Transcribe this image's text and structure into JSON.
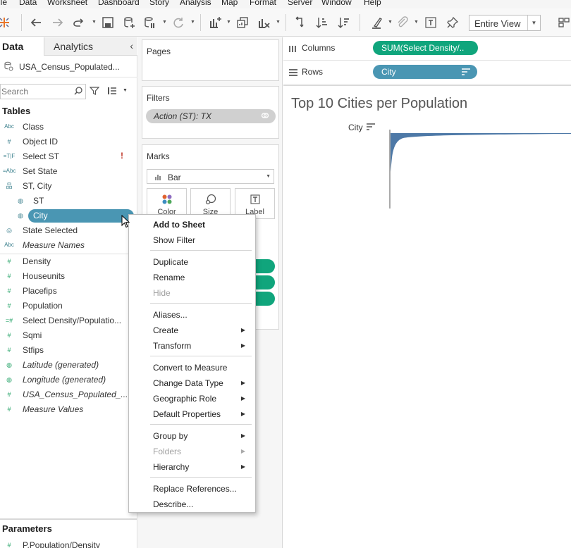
{
  "menubar": [
    "ile",
    "Data",
    "Worksheet",
    "Dashboard",
    "Story",
    "Analysis",
    "Map",
    "Format",
    "Server",
    "Window",
    "Help"
  ],
  "toolbar": {
    "view_fit": "Entire View"
  },
  "datapane": {
    "tab_data": "Data",
    "tab_analytics": "Analytics",
    "datasource": "USA_Census_Populated...",
    "search_placeholder": "Search",
    "tables_title": "Tables",
    "dimensions": [
      {
        "icon": "Abc",
        "name": "Class"
      },
      {
        "icon": "#",
        "name": "Object ID"
      },
      {
        "icon": "=T|F",
        "name": "Select ST",
        "warning": "!"
      },
      {
        "icon": "=Abc",
        "name": "Set State"
      },
      {
        "icon": "hier",
        "name": "ST, City"
      },
      {
        "icon": "geo",
        "name": "ST"
      },
      {
        "icon": "geo",
        "name": "City"
      },
      {
        "icon": "set",
        "name": "State Selected"
      },
      {
        "icon": "Abc",
        "name": "Measure Names"
      }
    ],
    "measures": [
      {
        "icon": "#",
        "name": "Density"
      },
      {
        "icon": "#",
        "name": "Houseunits"
      },
      {
        "icon": "#",
        "name": "Placefips"
      },
      {
        "icon": "#",
        "name": "Population"
      },
      {
        "icon": "=#",
        "name": "Select Density/Populatio..."
      },
      {
        "icon": "#",
        "name": "Sqmi"
      },
      {
        "icon": "#",
        "name": "Stfips"
      },
      {
        "icon": "geo",
        "name": "Latitude (generated)"
      },
      {
        "icon": "geo",
        "name": "Longitude (generated)"
      },
      {
        "icon": "#",
        "name": "USA_Census_Populated_..."
      },
      {
        "icon": "#",
        "name": "Measure Values"
      }
    ],
    "parameters_title": "Parameters",
    "parameters": [
      {
        "name": "P.Population/Density"
      }
    ]
  },
  "cards": {
    "pages": "Pages",
    "filters": "Filters",
    "filter_pill": "Action (ST): TX",
    "marks": "Marks",
    "mark_type": "Bar",
    "mark_buttons": [
      "Color",
      "Size",
      "Label"
    ]
  },
  "shelves": {
    "columns_label": "Columns",
    "columns_pill": "SUM(Select Density/..",
    "rows_label": "Rows",
    "rows_pill": "City"
  },
  "viz": {
    "title": "Top 10 Cities per Population",
    "header": "City"
  },
  "context_menu": [
    {
      "label": "Add to Sheet",
      "bold": true
    },
    {
      "label": "Show Filter"
    },
    {
      "sep": true
    },
    {
      "label": "Duplicate"
    },
    {
      "label": "Rename"
    },
    {
      "label": "Hide",
      "disabled": true
    },
    {
      "sep": true
    },
    {
      "label": "Aliases..."
    },
    {
      "label": "Create",
      "submenu": true
    },
    {
      "label": "Transform",
      "submenu": true
    },
    {
      "sep": true
    },
    {
      "label": "Convert to Measure"
    },
    {
      "label": "Change Data Type",
      "submenu": true
    },
    {
      "label": "Geographic Role",
      "submenu": true
    },
    {
      "label": "Default Properties",
      "submenu": true
    },
    {
      "sep": true
    },
    {
      "label": "Group by",
      "submenu": true
    },
    {
      "label": "Folders",
      "submenu": true,
      "disabled": true
    },
    {
      "label": "Hierarchy",
      "submenu": true
    },
    {
      "sep": true
    },
    {
      "label": "Replace References..."
    },
    {
      "label": "Describe..."
    }
  ],
  "colors": {
    "dimension_pill": "#4a96b3",
    "measure_pill": "#10a57c",
    "bar": "#4e79a7"
  }
}
